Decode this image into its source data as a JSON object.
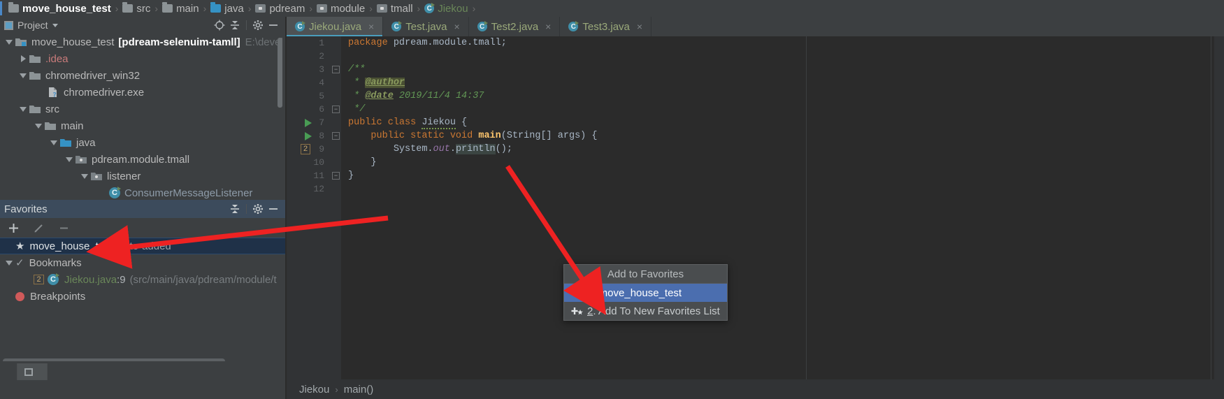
{
  "navbar": {
    "crumbs": [
      {
        "label": "move_house_test",
        "icon": "folder-icon",
        "style": "first"
      },
      {
        "label": "src",
        "icon": "folder-icon",
        "style": "plain"
      },
      {
        "label": "main",
        "icon": "folder-icon",
        "style": "plain"
      },
      {
        "label": "java",
        "icon": "source-folder-icon",
        "style": "plain"
      },
      {
        "label": "pdream",
        "icon": "package-icon",
        "style": "plain"
      },
      {
        "label": "module",
        "icon": "package-icon",
        "style": "plain"
      },
      {
        "label": "tmall",
        "icon": "package-icon",
        "style": "plain"
      },
      {
        "label": "Jiekou",
        "icon": "java-class-icon",
        "style": "green"
      }
    ],
    "separator": "›"
  },
  "project_panel": {
    "title": "Project",
    "dropdown_caret": "▾",
    "toolbar_icons": [
      "locate-target-icon",
      "collapse-all-icon",
      "gear-icon",
      "minimize-icon"
    ],
    "tree": [
      {
        "depth": 0,
        "twisty": "down",
        "icon": "module-folder-icon",
        "label": "move_house_test",
        "bold_suffix": "[pdream-selenuim-tamll]",
        "dim_suffix": "E:\\devel",
        "red": false
      },
      {
        "depth": 1,
        "twisty": "right",
        "icon": "folder-icon",
        "label": ".idea",
        "red": true
      },
      {
        "depth": 1,
        "twisty": "down",
        "icon": "folder-icon",
        "label": "chromedriver_win32",
        "red": false
      },
      {
        "depth": 2,
        "twisty": "none",
        "icon": "exe-file-icon",
        "label": "chromedriver.exe",
        "red": false
      },
      {
        "depth": 1,
        "twisty": "down",
        "icon": "folder-icon",
        "label": "src",
        "red": false
      },
      {
        "depth": 2,
        "twisty": "down",
        "icon": "folder-icon",
        "label": "main",
        "red": false
      },
      {
        "depth": 3,
        "twisty": "down",
        "icon": "source-folder-icon",
        "label": "java",
        "red": false
      },
      {
        "depth": 4,
        "twisty": "down",
        "icon": "package-icon",
        "label": "pdream.module.tmall",
        "red": false
      },
      {
        "depth": 5,
        "twisty": "down",
        "icon": "package-icon",
        "label": "listener",
        "red": false
      },
      {
        "depth": 6,
        "twisty": "none",
        "icon": "java-class-icon",
        "label": "ConsumerMessageListener",
        "red": false
      }
    ]
  },
  "favorites_panel": {
    "title": "Favorites",
    "header_icons": [
      "collapse-all-icon",
      "gear-icon",
      "minimize-icon"
    ],
    "toolbar": {
      "add_label": "+",
      "edit_label": "✎",
      "remove_label": "−"
    },
    "items": [
      {
        "type": "favorite",
        "icon": "star-icon",
        "label": "move_house_test",
        "suffix": "auto-added",
        "selected": true
      },
      {
        "type": "group",
        "icon": "check-icon",
        "twisty": "down",
        "label": "Bookmarks",
        "selected": false
      },
      {
        "type": "bookmark",
        "icon": "java-class-icon",
        "badge": "2",
        "label": "Jiekou.java",
        "line": ":9",
        "path": "(src/main/java/pdream/module/t",
        "selected": false
      },
      {
        "type": "group",
        "icon": "breakpoint-icon",
        "label": "Breakpoints",
        "selected": false
      }
    ]
  },
  "editor": {
    "tabs": [
      {
        "label": "Jiekou.java",
        "active": true,
        "icon": "java-class-run-icon",
        "close": "×"
      },
      {
        "label": "Test.java",
        "active": false,
        "icon": "java-class-run-icon",
        "close": "×"
      },
      {
        "label": "Test2.java",
        "active": false,
        "icon": "java-class-run-icon",
        "close": "×"
      },
      {
        "label": "Test3.java",
        "active": false,
        "icon": "java-class-run-icon",
        "close": "×"
      }
    ],
    "line_numbers": [
      "1",
      "2",
      "3",
      "4",
      "5",
      "6",
      "7",
      "8",
      "9",
      "10",
      "11",
      "12"
    ],
    "code": {
      "l1_kw": "package",
      "l1_rest": " pdream.module.tmall;",
      "l3": "/**",
      "l4_star": " * ",
      "l4_tag": "@author",
      "l5_star": " * ",
      "l5_tag": "@date",
      "l5_rest": " 2019/11/4 14:37",
      "l6": " */",
      "l7_kw": "public class ",
      "l7_name": "Jiekou",
      "l7_brace": " {",
      "l8_kw": "public static void ",
      "l8_name": "main",
      "l8_args": "(String[] args) {",
      "l9_a": "System.",
      "l9_out": "out",
      "l9_b": ".",
      "l9_println": "println",
      "l9_c": "();",
      "l10": "}",
      "l11": "}"
    },
    "gutter_markers": {
      "line7": "run-gutter-icon",
      "line8": "run-gutter-icon",
      "line9_bookmark": "2"
    },
    "breadcrumb": {
      "class": "Jiekou",
      "separator": "›",
      "method": "main()"
    }
  },
  "context_menu": {
    "title": "Add to Favorites",
    "items": [
      {
        "mnemonic": "1",
        "label": ". move_house_test",
        "selected": true,
        "icon": null
      },
      {
        "mnemonic": "2",
        "label": ". Add To New Favorites List",
        "selected": false,
        "icon": "add-to-new-list-icon"
      }
    ]
  },
  "colors": {
    "accent_blue": "#4b6eaf",
    "arrow_red": "#ee2222",
    "tab_underline": "#4a9ebd",
    "keyword_orange": "#cc7832",
    "comment_green": "#629755",
    "method_yellow": "#ffc66d",
    "field_purple": "#9876aa"
  }
}
